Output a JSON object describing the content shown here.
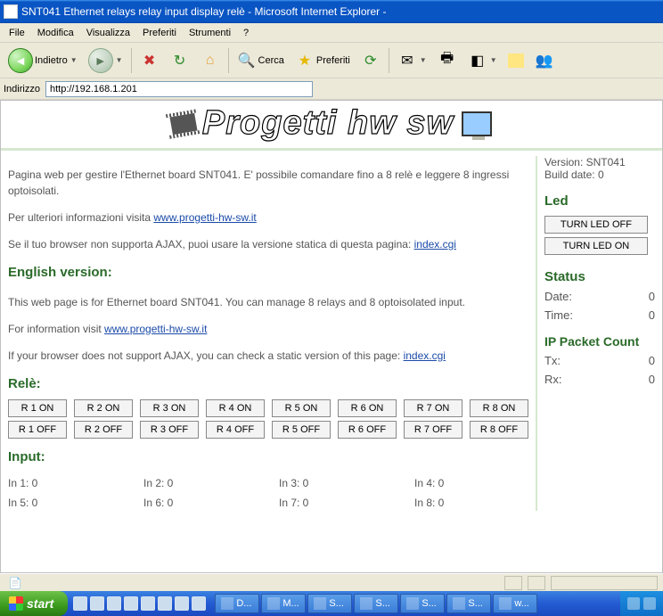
{
  "window": {
    "title": "SNT041 Ethernet relays relay input display relè - Microsoft Internet Explorer -"
  },
  "menu": [
    "File",
    "Modifica",
    "Visualizza",
    "Preferiti",
    "Strumenti",
    "?"
  ],
  "toolbar": {
    "back": "Indietro",
    "search": "Cerca",
    "favorites": "Preferiti"
  },
  "address": {
    "label": "Indirizzo",
    "url": "http://192.168.1.201"
  },
  "banner": "Progetti hw sw",
  "content": {
    "it_p1": "Pagina web per gestire l'Ethernet board SNT041. E' possibile comandare fino a 8 relè e leggere 8 ingressi optoisolati.",
    "it_visit_pre": "Per ulteriori informazioni visita ",
    "it_ajax_pre": "Se il tuo browser non supporta AJAX, puoi usare la versione statica di questa pagina: ",
    "link_site": "www.progetti-hw-sw.it",
    "link_index": "index.cgi",
    "en_heading": "English version:",
    "en_p1": "This web page is for Ethernet board SNT041. You can manage 8 relays and 8 optoisolated input.",
    "en_visit_pre": "For information visit ",
    "en_ajax_pre": "If your browser does not support AJAX, you can check a static version of this page: ",
    "rele_heading": "Relè:",
    "rele_on": [
      "R 1 ON",
      "R 2 ON",
      "R 3 ON",
      "R 4 ON",
      "R 5 ON",
      "R 6 ON",
      "R 7 ON",
      "R 8 ON"
    ],
    "rele_off": [
      "R 1 OFF",
      "R 2 OFF",
      "R 3 OFF",
      "R 4 OFF",
      "R 5 OFF",
      "R 6 OFF",
      "R 7 OFF",
      "R 8 OFF"
    ],
    "input_heading": "Input:",
    "inputs": [
      "In 1: 0",
      "In 2: 0",
      "In 3: 0",
      "In 4: 0",
      "In 5: 0",
      "In 6: 0",
      "In 7: 0",
      "In 8: 0"
    ]
  },
  "side": {
    "version": "Version: SNT041",
    "build": "Build date: 0",
    "led_heading": "Led",
    "led_off": "TURN LED OFF",
    "led_on": "TURN LED ON",
    "status_heading": "Status",
    "date_label": "Date:",
    "date_val": "0",
    "time_label": "Time:",
    "time_val": "0",
    "ip_heading": "IP Packet Count",
    "tx_label": "Tx:",
    "tx_val": "0",
    "rx_label": "Rx:",
    "rx_val": "0"
  },
  "taskbar": {
    "start": "start",
    "tasks": [
      "D...",
      "M...",
      "S...",
      "S...",
      "S...",
      "S...",
      "w..."
    ]
  }
}
